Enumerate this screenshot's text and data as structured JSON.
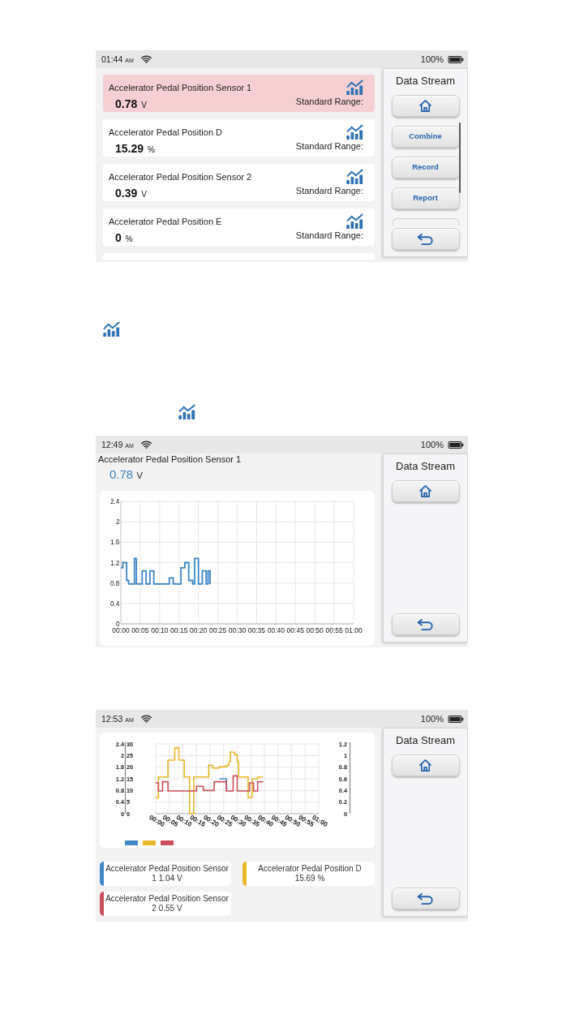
{
  "screens": [
    {
      "kind": "list",
      "status_bar": {
        "time": "01:44",
        "meridiem": "AM",
        "battery": "100%"
      },
      "items": [
        {
          "name": "Accelerator Pedal Position Sensor 1",
          "value": "0.78",
          "unit": "V",
          "range_label": "Standard Range:",
          "selected": true
        },
        {
          "name": "Accelerator Pedal Position D",
          "value": "15.29",
          "unit": "%",
          "range_label": "Standard Range:",
          "selected": false
        },
        {
          "name": "Accelerator Pedal Position Sensor 2",
          "value": "0.39",
          "unit": "V",
          "range_label": "Standard Range:",
          "selected": false
        },
        {
          "name": "Accelerator Pedal Position E",
          "value": "0",
          "unit": "%",
          "range_label": "Standard Range:",
          "selected": false
        }
      ],
      "side_panel": {
        "title": "Data Stream",
        "buttons": [
          "Combine",
          "Record",
          "Report"
        ]
      }
    },
    {
      "kind": "graph",
      "status_bar": {
        "time": "12:49",
        "meridiem": "AM",
        "battery": "100%"
      },
      "title": "Accelerator Pedal Position Sensor 1",
      "value": "0.78",
      "unit": "V",
      "chart_data": {
        "type": "line",
        "grid": true,
        "x": [
          0,
          0.5,
          1,
          1.5,
          2,
          2.5,
          3,
          3.5,
          4,
          4.5,
          5,
          5.5,
          6,
          6.5,
          7,
          7.5,
          8,
          8.5,
          9,
          9.5,
          10,
          10.5,
          11,
          11.5,
          12,
          12.5,
          13,
          13.5,
          14,
          14.5,
          15,
          15.5,
          16,
          16.5,
          17,
          17.5,
          18,
          18.5,
          19,
          19.5,
          20,
          20.5,
          21,
          21.5,
          22,
          22.5,
          23
        ],
        "values": [
          1.1,
          1.2,
          1.2,
          0.85,
          0.78,
          0.78,
          0.78,
          1.28,
          0.78,
          0.78,
          0.78,
          1.04,
          1.04,
          0.78,
          0.78,
          1.04,
          1.04,
          0.78,
          0.78,
          0.78,
          0.78,
          0.78,
          0.78,
          0.78,
          0.78,
          0.9,
          0.9,
          0.78,
          0.78,
          0.78,
          0.78,
          1.1,
          1.1,
          1.2,
          1.2,
          0.85,
          0.85,
          0.78,
          1.28,
          1.28,
          0.78,
          0.78,
          1.04,
          1.04,
          0.78,
          1.04,
          0.78
        ],
        "xlim": [
          0,
          60
        ],
        "ylim": [
          0,
          2.4
        ],
        "xticks": [
          {
            "value": 0,
            "label": "00:00"
          },
          {
            "value": 5,
            "label": "00:05"
          },
          {
            "value": 10,
            "label": "00:10"
          },
          {
            "value": 15,
            "label": "00:15"
          },
          {
            "value": 20,
            "label": "00:20"
          },
          {
            "value": 25,
            "label": "00:25"
          },
          {
            "value": 30,
            "label": "00:30"
          },
          {
            "value": 35,
            "label": "00:35"
          },
          {
            "value": 40,
            "label": "00:40"
          },
          {
            "value": 45,
            "label": "00:45"
          },
          {
            "value": 50,
            "label": "00:50"
          },
          {
            "value": 55,
            "label": "00:55"
          },
          {
            "value": 60,
            "label": "01:00"
          }
        ],
        "yticks": [
          {
            "value": 0,
            "label": "0"
          },
          0.4,
          0.8,
          1.2,
          1.6,
          2,
          2.4
        ]
      },
      "side_panel": {
        "title": "Data Stream"
      }
    },
    {
      "kind": "combined",
      "status_bar": {
        "time": "12:53",
        "meridiem": "AM",
        "battery": "100%"
      },
      "chart_data": {
        "type": "line",
        "grid": true,
        "x": [
          0,
          0.5,
          1,
          1.5,
          2,
          2.5,
          3,
          3.5,
          4,
          4.5,
          5,
          5.5,
          6,
          6.5,
          7,
          7.5,
          8,
          8.5,
          9,
          9.5,
          10,
          10.5,
          11,
          11.5,
          12,
          12.5,
          13,
          13.5,
          14,
          14.5,
          15,
          15.5,
          16,
          16.5,
          17,
          17.5,
          18,
          18.5,
          19,
          19.5,
          20,
          20.5,
          21,
          21.5,
          22,
          22.5,
          23,
          23.5,
          24,
          24.5,
          25,
          25.5,
          26,
          26.5,
          27,
          27.5,
          28,
          28.5,
          29,
          29.5,
          30,
          30.5,
          31,
          31.5,
          32,
          32.5,
          33,
          33.5,
          34,
          34.5,
          35,
          35.5,
          36,
          36.5,
          37,
          37.5,
          38,
          38.5,
          39,
          39.5
        ],
        "xlim": [
          0,
          60
        ],
        "ylim": [
          0,
          2.4
        ],
        "xticks": [
          {
            "value": 0,
            "label": "00:00"
          },
          {
            "value": 5,
            "label": "00:05"
          },
          {
            "value": 10,
            "label": "00:10"
          },
          {
            "value": 15,
            "label": "00:15"
          },
          {
            "value": 20,
            "label": "00:20"
          },
          {
            "value": 25,
            "label": "00:25"
          },
          {
            "value": 30,
            "label": "00:30"
          },
          {
            "value": 35,
            "label": "00:35"
          },
          {
            "value": 40,
            "label": "00:40"
          },
          {
            "value": 45,
            "label": "00:45"
          },
          {
            "value": 50,
            "label": "00:50"
          },
          {
            "value": 55,
            "label": "00:55"
          },
          {
            "value": 60,
            "label": "01:00"
          }
        ],
        "yticks": [
          {
            "value": 0,
            "label": "0"
          },
          0.4,
          0.8,
          1.2,
          1.6,
          2,
          2.4
        ],
        "y2lim": [
          0,
          30
        ],
        "y2ticks": [
          {
            "value": 0,
            "label": "0"
          },
          5,
          10,
          15,
          20,
          25,
          30
        ],
        "y3lim": [
          0,
          1.2
        ],
        "y3ticks": [
          {
            "value": 0,
            "label": "0"
          },
          0.2,
          0.4,
          0.6,
          0.8,
          1,
          1.2
        ],
        "series": [
          {
            "color": "#4288c9",
            "values": [
              null,
              null,
              null,
              null,
              null,
              null,
              null,
              null,
              null,
              null,
              null,
              null,
              null,
              null,
              null,
              null,
              null,
              null,
              null,
              null,
              null,
              null,
              null,
              null,
              null,
              null,
              null,
              null,
              null,
              null,
              null,
              null,
              null,
              null,
              null,
              null,
              null,
              null,
              null,
              null,
              null,
              null,
              null,
              null,
              null,
              null,
              null,
              1.2,
              1.2,
              1.2,
              1.2,
              1.2,
              0.88,
              0.88,
              null,
              null,
              null,
              null,
              null,
              null,
              null,
              null,
              null,
              null,
              null,
              null,
              null,
              null,
              null,
              null,
              null,
              null,
              null,
              null,
              null,
              null,
              null,
              null,
              null,
              null
            ]
          },
          {
            "color": "#e8b828",
            "axis": "y2",
            "values": [
              6.9,
              6.9,
              15.8,
              15.8,
              15.8,
              15.8,
              15.8,
              15.8,
              15.8,
              23,
              23,
              23,
              23,
              23,
              28.3,
              28.3,
              28.3,
              23,
              23,
              23,
              23,
              15.8,
              15.8,
              15.8,
              15.8,
              0,
              0,
              0,
              15.8,
              15.8,
              15.8,
              15.8,
              15.8,
              15.8,
              15.8,
              15.8,
              15.8,
              15.8,
              15.8,
              20.8,
              20.8,
              20.8,
              19.6,
              19.6,
              19.6,
              19.6,
              19.6,
              20.2,
              20.2,
              20.2,
              20.2,
              20.2,
              20.8,
              20.8,
              22.5,
              26.5,
              26.5,
              26.5,
              25.4,
              25.4,
              22.5,
              15.8,
              15.8,
              15.8,
              15.8,
              15.8,
              15.8,
              15.8,
              6.9,
              6.9,
              6.9,
              15,
              15,
              15,
              15,
              15.8,
              15.8,
              15.8,
              15.8,
              15.8
            ]
          },
          {
            "color": "#c9505a",
            "axis": "y3",
            "values": [
              0.53,
              0.53,
              0.39,
              0.39,
              0.39,
              0.55,
              0.55,
              0.55,
              0.55,
              0.39,
              0.39,
              0.39,
              0.39,
              0.39,
              0.39,
              0.39,
              0.39,
              0.39,
              0.39,
              0.39,
              0.39,
              0.39,
              0.39,
              0.39,
              0.39,
              0.39,
              0.39,
              0.39,
              0.39,
              0.39,
              0.47,
              0.47,
              0.47,
              0.47,
              0.47,
              0.4,
              0.4,
              0.4,
              0.4,
              0.4,
              0.4,
              0.4,
              0.4,
              0.55,
              0.55,
              0.55,
              0.55,
              0.55,
              0.55,
              0.55,
              0.55,
              0.55,
              0.39,
              0.39,
              0.39,
              0.39,
              0.39,
              0.65,
              0.65,
              0.65,
              0.39,
              0.39,
              0.39,
              0.39,
              0.39,
              0.39,
              0.39,
              0.39,
              0.39,
              0.53,
              0.53,
              0.53,
              0.39,
              0.39,
              0.39,
              0.55,
              0.55,
              0.55,
              0.55,
              0.55
            ]
          }
        ]
      },
      "series_cards": [
        {
          "name": "Accelerator Pedal Position Sensor 1",
          "value": "1.04",
          "unit": "V",
          "color": "#4288c9"
        },
        {
          "name": "Accelerator Pedal Position D",
          "value": "15.69",
          "unit": "%",
          "color": "#e8b828"
        },
        {
          "name": "Accelerator Pedal Position Sensor 2",
          "value": "0.55",
          "unit": "V",
          "color": "#c9505a"
        }
      ],
      "side_panel": {
        "title": "Data Stream"
      }
    }
  ]
}
